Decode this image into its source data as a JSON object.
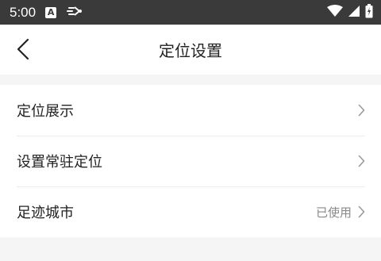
{
  "status_bar": {
    "time": "5:00",
    "notification_icon_letter": "A",
    "icons": [
      "notification-a-icon",
      "cast-icon",
      "wifi-icon",
      "signal-icon",
      "battery-icon"
    ]
  },
  "header": {
    "title": "定位设置",
    "back_icon": "chevron-left-icon"
  },
  "settings": {
    "items": [
      {
        "label": "定位展示",
        "value": ""
      },
      {
        "label": "设置常驻定位",
        "value": ""
      },
      {
        "label": "足迹城市",
        "value": "已使用"
      }
    ]
  },
  "colors": {
    "status_bar_bg": "#3a3a3a",
    "page_bg": "#f5f5f5",
    "card_bg": "#ffffff",
    "text_primary": "#222222",
    "text_secondary": "#888888",
    "chevron": "#999999"
  }
}
